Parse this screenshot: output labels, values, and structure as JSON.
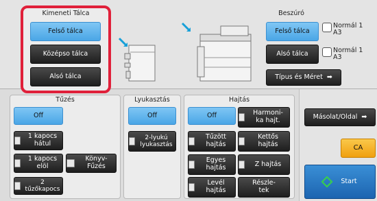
{
  "output_tray": {
    "title": "Kimeneti Tálca",
    "options": [
      "Felső tálca",
      "Középso tálca",
      "Alsó tálca"
    ]
  },
  "input_tray": {
    "title": "Beszúró",
    "upper": "Felső tálca",
    "lower": "Alsó tálca",
    "upper_paper": "Normál 1\nA3",
    "lower_paper": "Normál 1\nA3",
    "type_size": "Típus és Méret"
  },
  "stapling": {
    "title": "Tűzés",
    "off": "Off",
    "one_back": "1 kapocs\nhátul",
    "one_front": "1 kapocs\nelöl",
    "book": "Könyv-\nFűzés",
    "two": "2 tűzőkapocs"
  },
  "punch": {
    "title": "Lyukasztás",
    "off": "Off",
    "two_hole": "2-lyukú\nlyukasztás"
  },
  "fold": {
    "title": "Hajtás",
    "off": "Off",
    "accordion": "Harmoni-\nka hajt.",
    "saddle": "Tűzött\nhajtás",
    "double": "Kettős\nhajtás",
    "single": "Egyes\nhajtás",
    "z": "Z hajtás",
    "letter": "Levél\nhajtás",
    "detail": "Részle-\ntek"
  },
  "side": {
    "copy_side": "Másolat/Oldal",
    "ca": "CA",
    "start": "Start"
  },
  "colors": {
    "highlight": "#e0203a",
    "blue": "#5ab0ea",
    "dark": "#2a2a2a",
    "ca": "#f4b020"
  }
}
